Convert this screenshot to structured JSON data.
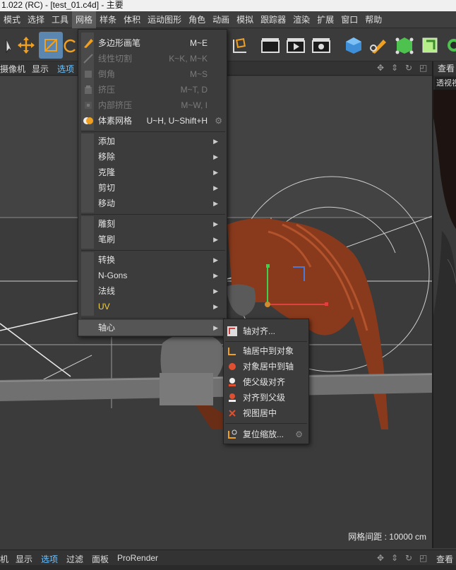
{
  "window": {
    "title": "1.022 (RC) - [test_01.c4d] - 主要"
  },
  "menubar": [
    "模式",
    "选择",
    "工具",
    "网格",
    "样条",
    "体积",
    "运动图形",
    "角色",
    "动画",
    "模拟",
    "跟踪器",
    "渲染",
    "扩展",
    "窗口",
    "帮助"
  ],
  "menubar_active": "网格",
  "viewport_header": {
    "items": [
      "摄像机",
      "显示",
      "选项"
    ],
    "right_label": "查看",
    "camera_label": "透视视"
  },
  "bottom_bar": {
    "items": [
      "机",
      "显示",
      "选项",
      "过滤",
      "面板",
      "ProRender"
    ],
    "right_label": "查看"
  },
  "grid_spacing": "网格间距 : 10000 cm",
  "dropdown": {
    "group1": [
      {
        "label": "多边形画笔",
        "shortcut": "M~E",
        "disabled": false
      },
      {
        "label": "线性切割",
        "shortcut": "K~K, M~K",
        "disabled": true
      },
      {
        "label": "倒角",
        "shortcut": "M~S",
        "disabled": true
      },
      {
        "label": "挤压",
        "shortcut": "M~T, D",
        "disabled": true
      },
      {
        "label": "内部挤压",
        "shortcut": "M~W, I",
        "disabled": true
      },
      {
        "label": "体素网格",
        "shortcut": "U~H, U~Shift+H",
        "disabled": false
      }
    ],
    "group2": [
      "添加",
      "移除",
      "克隆",
      "剪切",
      "移动"
    ],
    "group3": [
      "雕刻",
      "笔刷"
    ],
    "group4": [
      "转换",
      "N-Gons",
      "法线",
      "UV"
    ],
    "group5": [
      "轴心"
    ]
  },
  "submenu": {
    "items": [
      "轴对齐...",
      "轴居中到对象",
      "对象居中到轴",
      "使父级对齐",
      "对齐到父级",
      "视图居中",
      "复位缩放..."
    ]
  },
  "colors": {
    "accent": "#5b86b0",
    "uv": "#f2d14a",
    "hair": "#8a3a1c"
  }
}
